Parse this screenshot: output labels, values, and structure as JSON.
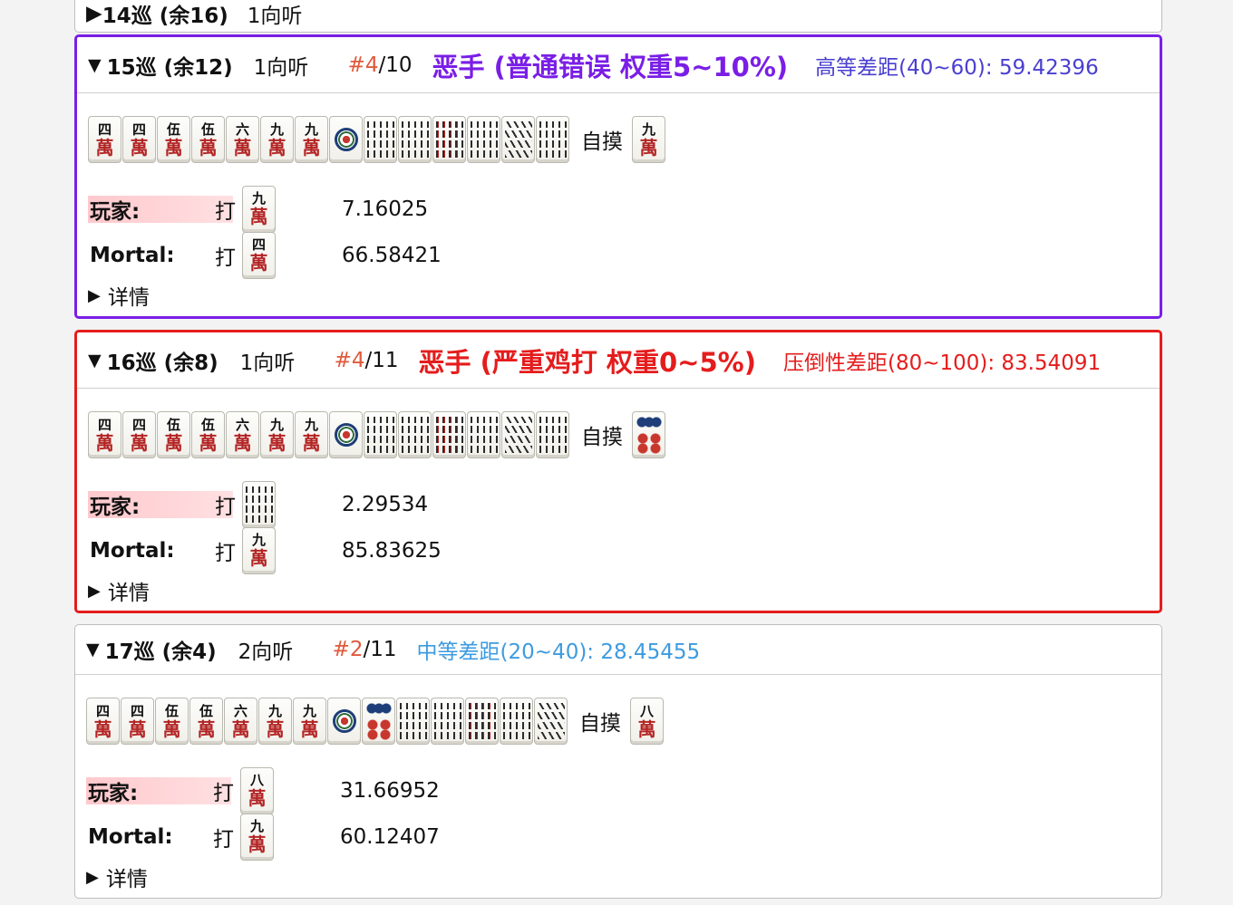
{
  "prev_round": {
    "turn": "14巡 (余16)",
    "shanten": "1向听"
  },
  "colors": {
    "purple": "#7a1ee6",
    "red": "#e51c1c",
    "blue": "#3d9be0",
    "rank": "#e0593b"
  },
  "labels": {
    "tsumo": "自摸",
    "discard": "打",
    "player": "玩家:",
    "mortal": "Mortal:",
    "details": "详情"
  },
  "rounds": [
    {
      "turn": "15巡 (余12)",
      "shanten": "1向听",
      "rank": "#4",
      "total": "/10",
      "bad": "恶手 (普通错误 权重5~10%)",
      "gap": "高等差距(40~60): 59.42396",
      "hand": [
        "4m",
        "4m",
        "5m",
        "5m",
        "6m",
        "9m",
        "9m",
        "1p",
        "2s",
        "2s",
        "3s",
        "6s",
        "7s",
        "8s"
      ],
      "draw": "9m",
      "player_tile": "9m",
      "player_ev": "7.16025",
      "mortal_tile": "4m",
      "mortal_ev": "66.58421"
    },
    {
      "turn": "16巡 (余8)",
      "shanten": "1向听",
      "rank": "#4",
      "total": "/11",
      "bad": "恶手 (严重鸡打 权重0~5%)",
      "gap": "压倒性差距(80~100): 83.54091",
      "hand": [
        "4m",
        "4m",
        "5m",
        "5m",
        "6m",
        "9m",
        "9m",
        "1p",
        "2s",
        "2s",
        "3s",
        "6s",
        "7s",
        "8s"
      ],
      "draw": "6p",
      "player_tile": "8s",
      "player_ev": "2.29534",
      "mortal_tile": "9m",
      "mortal_ev": "85.83625"
    },
    {
      "turn": "17巡 (余4)",
      "shanten": "2向听",
      "rank": "#2",
      "total": "/11",
      "bad": "",
      "gap": "中等差距(20~40): 28.45455",
      "hand": [
        "4m",
        "4m",
        "5m",
        "5m",
        "6m",
        "9m",
        "9m",
        "1p",
        "6p",
        "2s",
        "2s",
        "3s",
        "6s",
        "7s"
      ],
      "draw": "8m",
      "player_tile": "8m",
      "player_ev": "31.66952",
      "mortal_tile": "9m",
      "mortal_ev": "60.12407"
    }
  ]
}
